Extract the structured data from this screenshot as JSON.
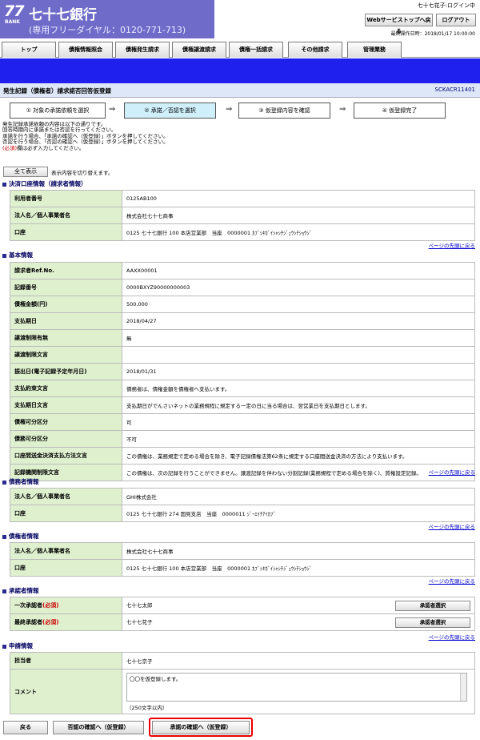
{
  "header": {
    "logo_number": "77",
    "logo_bank": "BANK",
    "bank_name": "七十七銀行",
    "freedial": "(専用フリーダイヤル：0120-771-713)",
    "user_status": "七十七花子:ログイン中",
    "web_top": "Webサービストップへ戻る",
    "logout": "ログアウト",
    "last_op": "最終操作日時：2018/01/17 10:00:00"
  },
  "tabs": [
    "トップ",
    "債権情報照会",
    "債権発生請求",
    "債権譲渡請求",
    "債権一括請求",
    "その他請求",
    "管理業務"
  ],
  "page": {
    "title": "発生記録（債権者）請求諾否回答仮登録",
    "screen_id": "SCKACR11401"
  },
  "steps": [
    "① 対象の承諾依頼を選択",
    "② 承諾／否認を選択",
    "③ 仮登録内容を確認",
    "④ 仮登録完了"
  ],
  "arrow": "⇒",
  "instructions": [
    "発生記録承諾依頼の内容は以下の通りです。",
    "回答時期内に承諾または否認を行ってください。",
    "承諾を行う場合、「承諾の確認へ（仮登録）」ボタンを押してください。",
    "否認を行う場合、「否認の確認へ（仮登録）」ボタンを押してください。"
  ],
  "required_note": {
    "tag": "(必須)",
    "text": "欄は必ず入力してください。"
  },
  "show_all": {
    "label": "全て表示",
    "note": "表示内容を切り替えます。"
  },
  "top_link": "ページの先頭に戻る",
  "settlement": {
    "title": "決済口座情報（請求者情報）",
    "rows": [
      [
        "利用者番号",
        "0125AB100"
      ],
      [
        "法人名／個人事業者名",
        "株式会社七十七商事"
      ],
      [
        "口座",
        "0125 七十七銀行 100 本店営業部　当座　0000001 ｶﾌﾞｼｷｶﾞｲｼｬｼﾁｼﾞｭｳｼﾁｼｮｳｼﾞ"
      ]
    ]
  },
  "basic": {
    "title": "基本情報",
    "rows": [
      [
        "請求者Ref.No.",
        "AAXX00001"
      ],
      [
        "記録番号",
        "0000BXYZ90000000003"
      ],
      [
        "債権金額(円)",
        "500,000"
      ],
      [
        "支払期日",
        "2018/04/27"
      ],
      [
        "譲渡制限有無",
        "無"
      ],
      [
        "譲渡制限文言",
        ""
      ],
      [
        "振出日(電子記録予定年月日)",
        "2018/01/31"
      ],
      [
        "支払約束文言",
        "債務者は、債権金額を債権者へ支払います。"
      ],
      [
        "支払期日文言",
        "支払期日がでんさいネットの業務規程に規定する一定の日に当る場合は、翌営業日を支払期日とします。"
      ],
      [
        "債権可分区分",
        "可"
      ],
      [
        "債務可分区分",
        "不可"
      ],
      [
        "口座間送金決済支払方法文言",
        "この債権は、業務規定で定める場合を除き、電子記録債権法第62条に規定する口座間送金決済の方法により支払います。"
      ],
      [
        "記録機関制限文言",
        "この債権は、次の記録を行うことができません。譲渡記録を伴わない分割記録(業務規程で定める場合を除く)、質権設定記録。"
      ]
    ]
  },
  "debtor": {
    "title": "債務者情報",
    "rows": [
      [
        "法人名／個人事業者名",
        "GHI株式会社"
      ],
      [
        "口座",
        "0125 七十七銀行 274 国見支店　当座　0000011 ｼﾞｰｴｲﾁｱｲｶﾌﾞ"
      ]
    ]
  },
  "creditor": {
    "title": "債権者情報",
    "rows": [
      [
        "法人名／個人事業者名",
        "株式会社七十七商事"
      ],
      [
        "口座",
        "0125 七十七銀行 100 本店営業部　当座　0000001 ｶﾌﾞｼｷｶﾞｲｼｬｼﾁｼﾞｭｳｼﾁｼｮｳｼﾞ"
      ]
    ]
  },
  "approver": {
    "title": "承認者情報",
    "first_label": "一次承認者",
    "final_label": "最終承認者",
    "req": "(必須)",
    "first_value": "七十七太郎",
    "final_value": "七十七花子",
    "select_btn": "承認者選択"
  },
  "apply": {
    "title": "申請情報",
    "person_label": "担当者",
    "person_value": "七十七京子",
    "comment_label": "コメント",
    "comment_value": "〇〇を仮登録します。",
    "comment_limit": "（250文字以内）"
  },
  "bottom": {
    "back": "戻る",
    "deny": "否認の確認へ（仮登録）",
    "approve": "承諾の確認へ（仮登録）"
  }
}
